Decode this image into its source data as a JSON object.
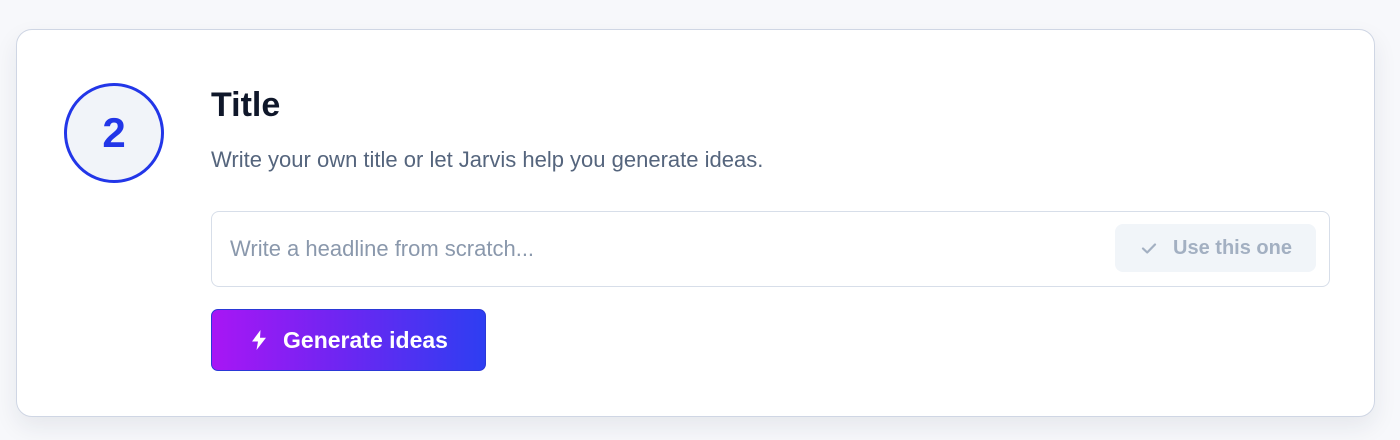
{
  "step": {
    "number": "2"
  },
  "section": {
    "title": "Title",
    "description": "Write your own title or let Jarvis help you generate ideas."
  },
  "headline": {
    "value": "",
    "placeholder": "Write a headline from scratch...",
    "confirm_label": "Use this one",
    "confirm_icon": "check-icon"
  },
  "actions": {
    "generate_label": "Generate ideas",
    "generate_icon": "lightning-icon"
  },
  "colors": {
    "accent_blue": "#2236e8",
    "gradient_start": "#a816f4",
    "gradient_end": "#2e3ef2",
    "title_text": "#0f172a",
    "muted_text": "#55657d"
  }
}
